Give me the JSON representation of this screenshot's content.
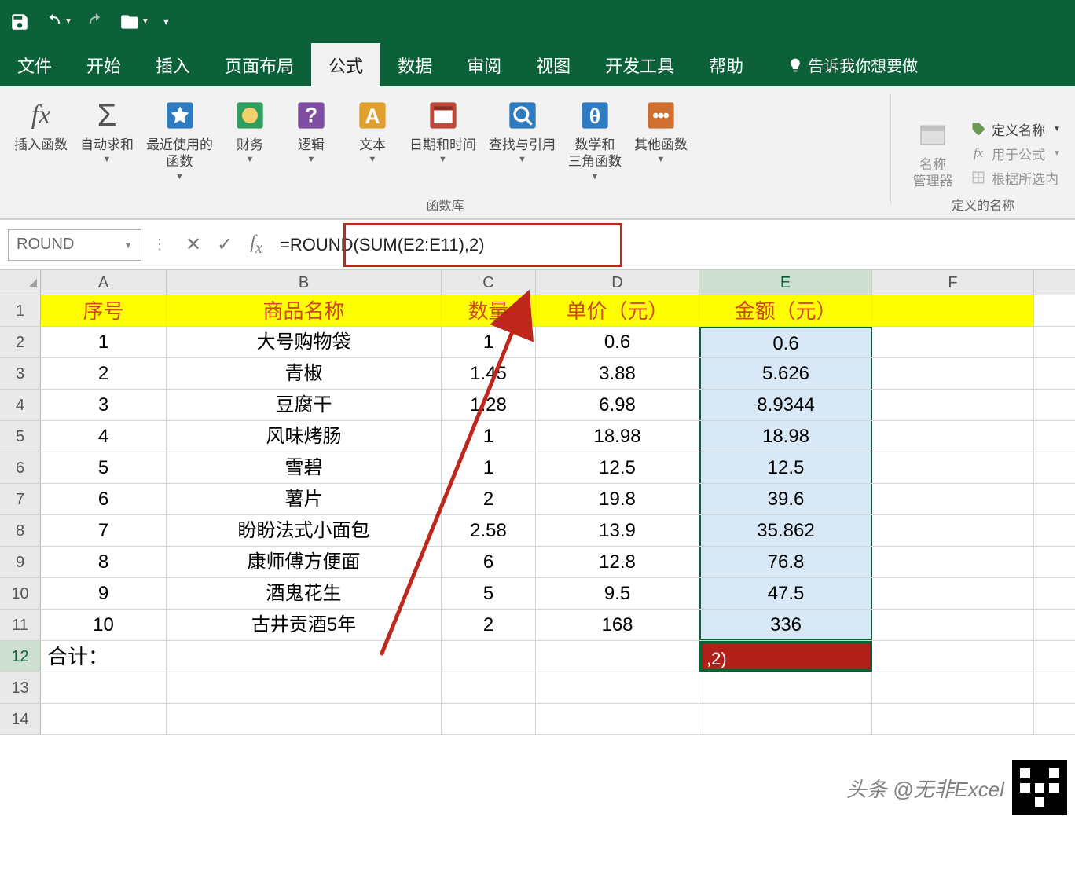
{
  "titlebar": {
    "save_icon": "save-icon",
    "undo_icon": "undo-icon",
    "redo_icon": "redo-icon",
    "folder_icon": "folder-icon"
  },
  "menu": {
    "tabs": [
      "文件",
      "开始",
      "插入",
      "页面布局",
      "公式",
      "数据",
      "审阅",
      "视图",
      "开发工具",
      "帮助"
    ],
    "active_index": 4,
    "tell_me": "告诉我你想要做"
  },
  "ribbon": {
    "insert_fn": "插入函数",
    "autosum": "自动求和",
    "recent": "最近使用的\n函数",
    "financial": "财务",
    "logical": "逻辑",
    "text": "文本",
    "datetime": "日期和时间",
    "lookup": "查找与引用",
    "math": "数学和\n三角函数",
    "other": "其他函数",
    "group1_label": "函数库",
    "name_mgr": "名称\n管理器",
    "def_name": "定义名称",
    "use_formula": "用于公式",
    "from_sel": "根据所选内",
    "group2_label": "定义的名称"
  },
  "formula_bar": {
    "name_box": "ROUND",
    "formula": "=ROUND(SUM(E2:E11),2)"
  },
  "grid": {
    "columns": [
      "A",
      "B",
      "C",
      "D",
      "E",
      "F"
    ],
    "headers": {
      "A": "序号",
      "B": "商品名称",
      "C": "数量",
      "D": "单价（元）",
      "E": "金额（元）",
      "F": ""
    },
    "rows": [
      {
        "r": 2,
        "A": "1",
        "B": "大号购物袋",
        "C": "1",
        "D": "0.6",
        "E": "0.6"
      },
      {
        "r": 3,
        "A": "2",
        "B": "青椒",
        "C": "1.45",
        "D": "3.88",
        "E": "5.626"
      },
      {
        "r": 4,
        "A": "3",
        "B": "豆腐干",
        "C": "1.28",
        "D": "6.98",
        "E": "8.9344"
      },
      {
        "r": 5,
        "A": "4",
        "B": "风味烤肠",
        "C": "1",
        "D": "18.98",
        "E": "18.98"
      },
      {
        "r": 6,
        "A": "5",
        "B": "雪碧",
        "C": "1",
        "D": "12.5",
        "E": "12.5"
      },
      {
        "r": 7,
        "A": "6",
        "B": "薯片",
        "C": "2",
        "D": "19.8",
        "E": "39.6"
      },
      {
        "r": 8,
        "A": "7",
        "B": "盼盼法式小面包",
        "C": "2.58",
        "D": "13.9",
        "E": "35.862"
      },
      {
        "r": 9,
        "A": "8",
        "B": "康师傅方便面",
        "C": "6",
        "D": "12.8",
        "E": "76.8"
      },
      {
        "r": 10,
        "A": "9",
        "B": "酒鬼花生",
        "C": "5",
        "D": "9.5",
        "E": "47.5"
      },
      {
        "r": 11,
        "A": "10",
        "B": "古井贡酒5年",
        "C": "2",
        "D": "168",
        "E": "336"
      }
    ],
    "total_label": "合计：",
    "editing_text": ",2)",
    "row_count_visible": [
      1,
      2,
      3,
      4,
      5,
      6,
      7,
      8,
      9,
      10,
      11,
      12,
      13,
      14
    ]
  },
  "watermark": "头条 @无非Excel"
}
